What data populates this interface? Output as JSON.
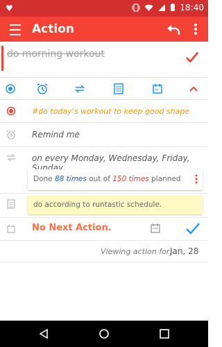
{
  "status": {
    "left_icon": "notification-heart-icon",
    "time": "18:40"
  },
  "appbar": {
    "title": "Action",
    "menu_icon": "hamburger-menu-icon",
    "undo_icon": "undo-icon",
    "more_icon": "more-vert-icon"
  },
  "task": {
    "text": "do morning workout",
    "done_icon": "check-icon",
    "done_color": "#f44336"
  },
  "toolbar": [
    {
      "name": "radio-icon"
    },
    {
      "name": "alarm-icon"
    },
    {
      "name": "repeat-icon"
    },
    {
      "name": "notes-icon"
    },
    {
      "name": "calendar-icon"
    },
    {
      "name": "chevron-up-icon"
    }
  ],
  "details": {
    "goal": "#do today's workout to keep good shape",
    "remind": "Remind me",
    "repeat": "on every Monday, Wednesday, Friday, Sunday",
    "progress": {
      "prefix": "Done",
      "done": "88 times",
      "middle": "out of",
      "planned": "150 times",
      "suffix": "planned"
    },
    "note": "do according to runtastic schedule.",
    "next_action": "No Next Action.",
    "viewing_label": "Viewing action for:",
    "viewing_date": "Jan, 28"
  },
  "colors": {
    "primary": "#f44336",
    "primary_dark": "#d32f2f",
    "accent_blue": "#2196f3",
    "orange": "#ff9800",
    "note_bg": "#fff9c4"
  }
}
